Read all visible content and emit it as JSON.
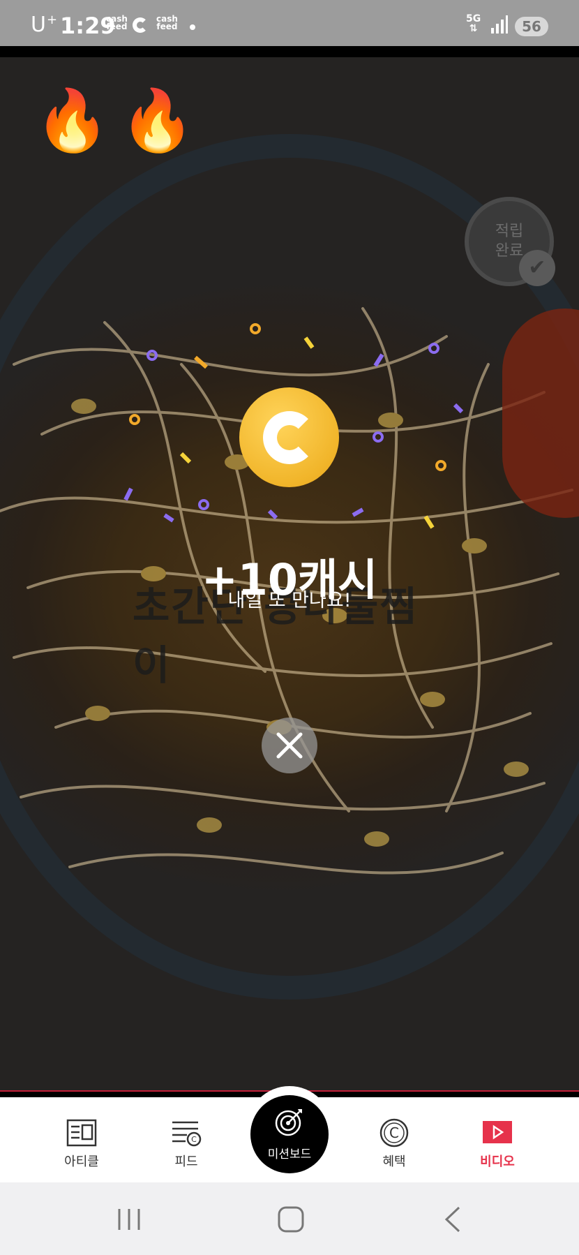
{
  "status_bar": {
    "carrier": "U",
    "carrier_sup": "+",
    "time": "1:29",
    "notif1": "cash\nfeed",
    "notif2": "cash\nfeed",
    "network": "5G",
    "battery": "56"
  },
  "video": {
    "caption": "초간단 콩나물찜이",
    "badge_label": "적립\n완료"
  },
  "reward": {
    "title": "+10캐시",
    "subtitle": "내일 또 만나요!"
  },
  "tabs": [
    {
      "label": "아티클",
      "icon": "article-icon"
    },
    {
      "label": "피드",
      "icon": "feed-icon"
    },
    {
      "label": "미션보드",
      "icon": "target-icon"
    },
    {
      "label": "혜택",
      "icon": "coin-icon"
    },
    {
      "label": "비디오",
      "icon": "video-play-icon",
      "active": true
    }
  ],
  "colors": {
    "accent": "#e6324b",
    "coin": "#f1b52a",
    "confetti_purple": "#8b6cf0",
    "confetti_orange": "#f2a92a",
    "confetti_yellow": "#f5d33a"
  }
}
